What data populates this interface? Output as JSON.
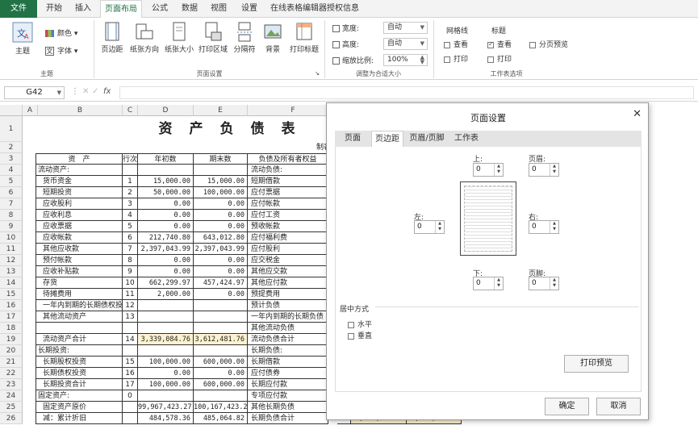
{
  "ribbon_tabs": [
    "文件",
    "开始",
    "插入",
    "页面布局",
    "公式",
    "数据",
    "视图",
    "设置",
    "在线表格编辑器授权信息"
  ],
  "ribbon": {
    "theme": {
      "main": "主题",
      "colors": "颜色",
      "fonts": "字体",
      "effects": "效果",
      "group": "主题"
    },
    "page_setup": {
      "margins": "页边距",
      "orientation": "纸张方向",
      "size": "纸张大小",
      "print_area": "打印区域",
      "breaks": "分隔符",
      "background": "背景",
      "print_titles": "打印标题",
      "group": "页面设置"
    },
    "scale": {
      "width_label": "宽度:",
      "width_value": "自动",
      "height_label": "高度:",
      "height_value": "自动",
      "scale_label": "缩放比例:",
      "scale_value": "100%",
      "group": "调整为合适大小"
    },
    "sheet_options": {
      "gridlines": "网格线",
      "headings": "标题",
      "view": "查看",
      "print": "打印",
      "page_break_preview": "分页预览",
      "group": "工作表选项"
    }
  },
  "formula_bar": {
    "name_box": "G42",
    "fx": "fx",
    "value": ""
  },
  "columns": [
    "A",
    "B",
    "C",
    "D",
    "E",
    "F"
  ],
  "rows": [
    "1",
    "2",
    "3",
    "4",
    "5",
    "6",
    "7",
    "8",
    "9",
    "10",
    "11",
    "12",
    "13",
    "14",
    "15",
    "16",
    "17",
    "18",
    "19",
    "20",
    "21",
    "22",
    "23",
    "24",
    "25",
    "26"
  ],
  "sheet": {
    "title": "资　产　负　债　表",
    "maker": "制表",
    "header": [
      "资　产",
      "行次",
      "年初数",
      "期末数",
      "负债及所有者权益"
    ],
    "table": [
      [
        "流动资产:",
        "",
        "",
        "",
        "流动负债:"
      ],
      [
        "货币资金",
        "1",
        "15,000.00",
        "15,000.00",
        "短期借款"
      ],
      [
        "短期投资",
        "2",
        "50,000.00",
        "100,000.00",
        "应付票据"
      ],
      [
        "应收股利",
        "3",
        "0.00",
        "0.00",
        "应付帐款"
      ],
      [
        "应收利息",
        "4",
        "0.00",
        "0.00",
        "应付工资"
      ],
      [
        "应收票据",
        "5",
        "0.00",
        "0.00",
        "预收帐款"
      ],
      [
        "应收帐款",
        "6",
        "212,740.80",
        "643,012.80",
        "应付福利费"
      ],
      [
        "其他应收款",
        "7",
        "2,397,043.99",
        "2,397,043.99",
        "应付股利"
      ],
      [
        "预付帐款",
        "8",
        "0.00",
        "0.00",
        "应交税金"
      ],
      [
        "应收补贴款",
        "9",
        "0.00",
        "0.00",
        "其他应交款"
      ],
      [
        "存货",
        "10",
        "662,299.97",
        "457,424.97",
        "其他应付款"
      ],
      [
        "待摊费用",
        "11",
        "2,000.00",
        "0.00",
        "预提费用"
      ],
      [
        "一年内到期的长期债权投资",
        "12",
        "",
        "",
        "预计负债"
      ],
      [
        "其他流动资产",
        "13",
        "",
        "",
        "一年内到期的长期负债"
      ],
      [
        "",
        "",
        "",
        "",
        "其他流动负债"
      ],
      [
        "流动资产合计",
        "14",
        "3,339,084.76",
        "3,612,481.76",
        "流动负债合计"
      ],
      [
        "长期投资:",
        "",
        "",
        "",
        "长期负债:"
      ],
      [
        "长期股权投资",
        "15",
        "100,000.00",
        "600,000.00",
        "长期借款"
      ],
      [
        "长期债权投资",
        "16",
        "0.00",
        "0.00",
        "应付债券"
      ],
      [
        "长期投资合计",
        "17",
        "100,000.00",
        "600,000.00",
        "长期应付款"
      ],
      [
        "固定资产:",
        "0",
        "",
        "",
        "专项应付款"
      ],
      [
        "固定资产原价",
        "",
        "99,967,423.27",
        "100,167,423.27",
        "其他长期负债"
      ],
      [
        "减：累计折旧",
        "",
        "484,578.36",
        "485,064.82",
        "长期负债合计"
      ]
    ],
    "extra_row26": [
      "51",
      "73,173,941.10",
      "73,183,941.10"
    ],
    "extra_row25": [
      "50"
    ]
  },
  "dialog": {
    "title": "页面设置",
    "tabs": [
      "页面",
      "页边距",
      "页眉/页脚",
      "工作表"
    ],
    "active_tab": "页边距",
    "top_label": "上:",
    "top_value": "0",
    "header_label": "页眉:",
    "header_value": "0",
    "left_label": "左:",
    "left_value": "0",
    "right_label": "右:",
    "right_value": "0",
    "bottom_label": "下:",
    "bottom_value": "0",
    "footer_label": "页脚:",
    "footer_value": "0",
    "center_title": "居中方式",
    "horizontal": "水平",
    "vertical": "垂直",
    "print_preview": "打印预览",
    "ok": "确定",
    "cancel": "取消"
  },
  "colors": {
    "excel_green": "#217346",
    "highlight": "#fdf2d0"
  }
}
